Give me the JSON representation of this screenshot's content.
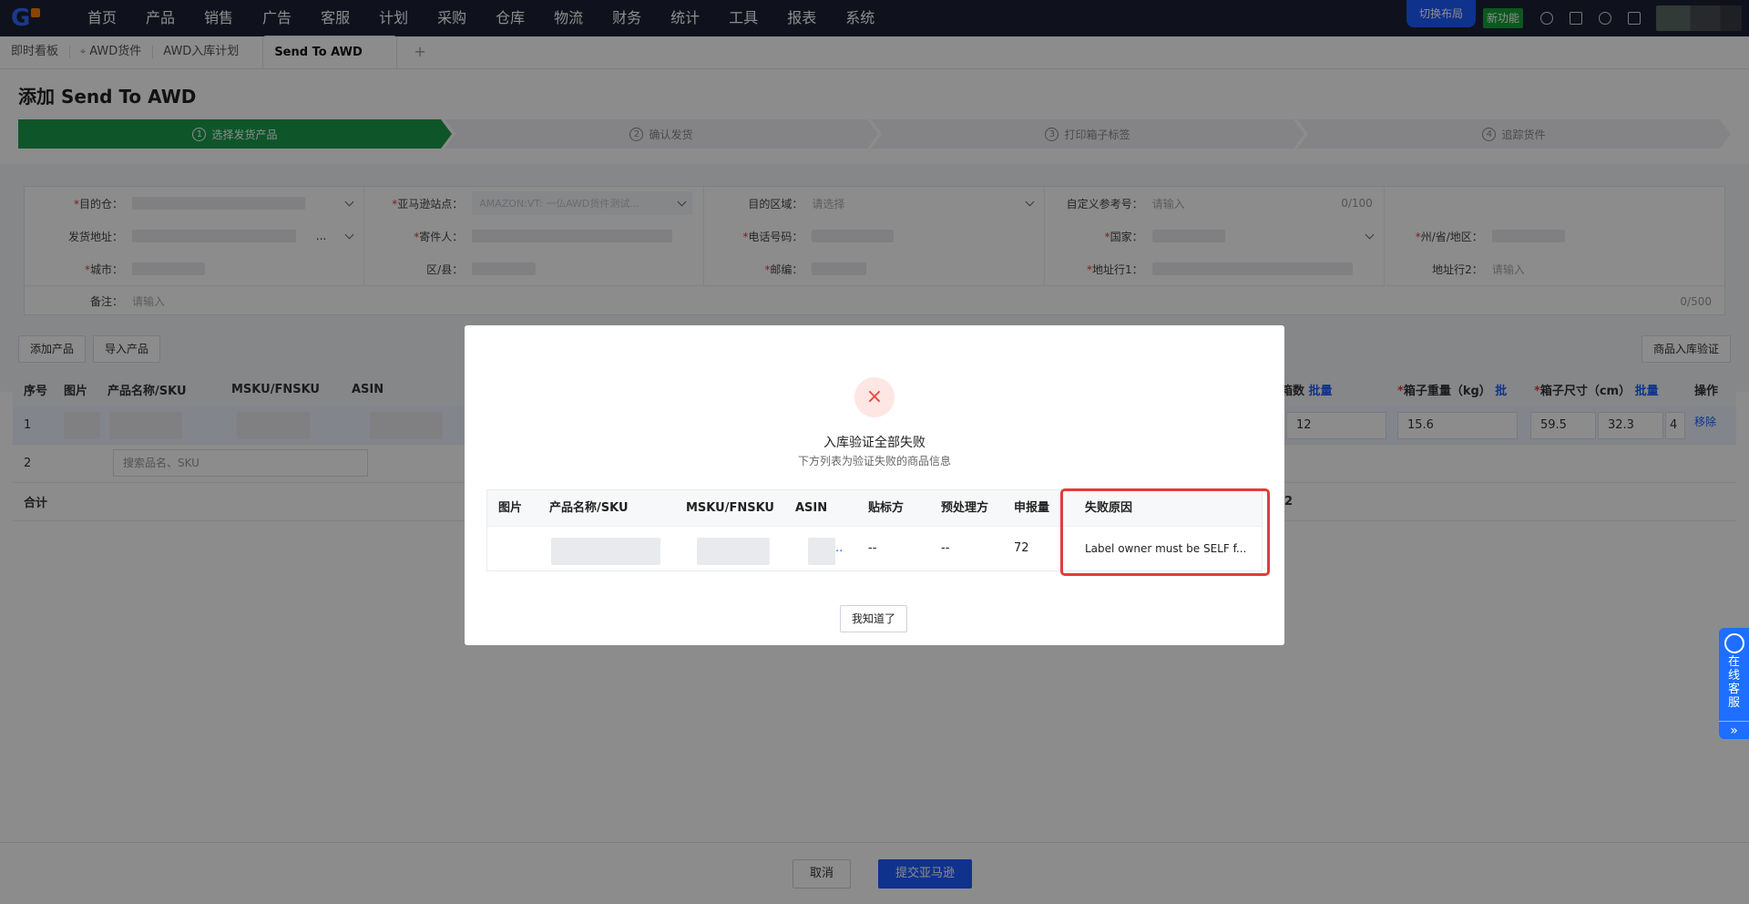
{
  "nav": {
    "items": [
      "首页",
      "产品",
      "销售",
      "广告",
      "客服",
      "计划",
      "采购",
      "仓库",
      "物流",
      "财务",
      "统计",
      "工具",
      "报表",
      "系统"
    ],
    "switch_layout": "切换布局",
    "new_feature": "新功能"
  },
  "tabs": {
    "t0": "即时看板",
    "t1": "AWD货件",
    "t2": "AWD入库计划",
    "t3": "Send To AWD",
    "add": "+"
  },
  "page": {
    "title": "添加 Send To AWD",
    "steps": [
      {
        "num": "1",
        "label": "选择发货产品"
      },
      {
        "num": "2",
        "label": "确认发货"
      },
      {
        "num": "3",
        "label": "打印箱子标签"
      },
      {
        "num": "4",
        "label": "追踪货件"
      }
    ]
  },
  "form": {
    "warehouse_label": "目的仓：",
    "marketplace_label": "亚马逊站点：",
    "marketplace_value": "AMAZON:VT: 一仏AWD货件测试...",
    "region_label": "目的区域：",
    "region_placeholder": "请选择",
    "ref_label": "自定义参考号：",
    "ref_placeholder": "请输入",
    "ref_count": "0/100",
    "ship_addr_label": "发货地址：",
    "ship_addr_suffix": "...",
    "sender_label": "寄件人：",
    "phone_label": "电话号码：",
    "country_label": "国家：",
    "state_label": "州/省/地区：",
    "city_label": "城市：",
    "district_label": "区/县：",
    "zip_label": "邮编：",
    "addr1_label": "地址行1：",
    "addr2_label": "地址行2：",
    "addr2_placeholder": "请输入",
    "remark_label": "备注：",
    "remark_placeholder": "请输入",
    "remark_count": "0/500"
  },
  "toolbar": {
    "add_product": "添加产品",
    "import_product": "导入产品",
    "verify": "商品入库验证"
  },
  "grid": {
    "headers": {
      "seq": "序号",
      "image": "图片",
      "name_sku": "产品名称/SKU",
      "msku": "MSKU/FNSKU",
      "asin": "ASIN",
      "boxes": "箱数",
      "boxes_batch": "批量",
      "weight": "箱子重量（kg）",
      "weight_batch": "批",
      "size": "箱子尺寸（cm）",
      "size_batch": "批量",
      "action": "操作"
    },
    "row1": {
      "seq": "1",
      "boxes": "12",
      "weight": "15.6",
      "dim1": "59.5",
      "dim2": "32.3",
      "dim3": "4",
      "remove": "移除"
    },
    "row2": {
      "seq": "2",
      "search_placeholder": "搜索品名、SKU"
    },
    "total_label": "合计",
    "total_boxes": "2"
  },
  "footer": {
    "cancel": "取消",
    "submit": "提交亚马逊"
  },
  "chat": {
    "text": "在线客服",
    "arrow": "»"
  },
  "modal": {
    "icon": "×",
    "title": "入库验证全部失败",
    "subtitle": "下方列表为验证失败的商品信息",
    "headers": {
      "image": "图片",
      "name_sku": "产品名称/SKU",
      "msku": "MSKU/FNSKU",
      "asin": "ASIN",
      "label_owner": "贴标方",
      "prep_owner": "预处理方",
      "quantity": "申报量",
      "reason": "失败原因"
    },
    "row": {
      "asin_tail": "..",
      "label_owner": "--",
      "prep_owner": "--",
      "quantity": "72",
      "reason": "Label owner must be SELF f..."
    },
    "ok_button": "我知道了"
  },
  "colors": {
    "nav_bg": "#1d2233",
    "accent": "#1d5cff",
    "step_active": "#1d9c4d",
    "error": "#e23b3b"
  }
}
